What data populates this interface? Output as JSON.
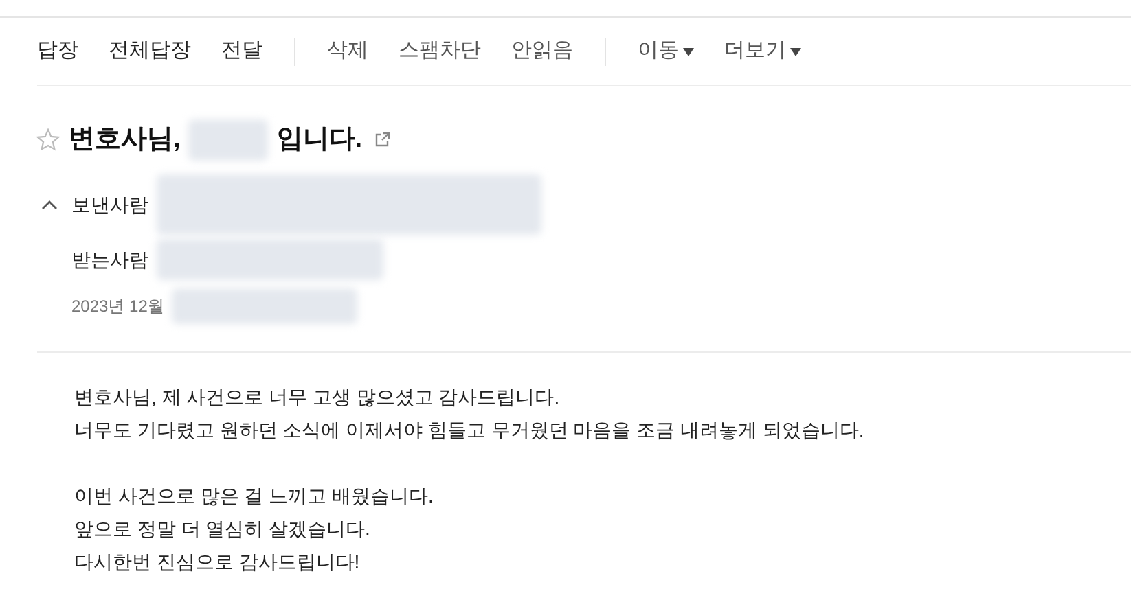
{
  "toolbar": {
    "groups": [
      [
        {
          "label": "답장",
          "kind": "primary",
          "dropdown": false
        },
        {
          "label": "전체답장",
          "kind": "primary",
          "dropdown": false
        },
        {
          "label": "전달",
          "kind": "primary",
          "dropdown": false
        }
      ],
      [
        {
          "label": "삭제",
          "kind": "secondary",
          "dropdown": false
        },
        {
          "label": "스팸차단",
          "kind": "secondary",
          "dropdown": false
        },
        {
          "label": "안읽음",
          "kind": "secondary",
          "dropdown": false
        }
      ],
      [
        {
          "label": "이동",
          "kind": "secondary",
          "dropdown": true
        },
        {
          "label": "더보기",
          "kind": "secondary",
          "dropdown": true
        }
      ]
    ]
  },
  "header": {
    "starred": false,
    "subject_start": "변호사님,",
    "subject_end": "입니다.",
    "sender_label": "보낸사람",
    "expanded": true,
    "recipient_label": "받는사람",
    "date": "2023년 12월"
  },
  "body": {
    "paragraphs": [
      [
        "변호사님, 제 사건으로 너무 고생 많으셨고 감사드립니다.",
        "너무도 기다렸고 원하던 소식에 이제서야 힘들고 무거웠던 마음을 조금 내려놓게 되었습니다."
      ],
      [
        "이번 사건으로 많은 걸 느끼고 배웠습니다.",
        "앞으로 정말 더 열심히 살겠습니다.",
        "다시한번 진심으로 감사드립니다!"
      ]
    ]
  }
}
